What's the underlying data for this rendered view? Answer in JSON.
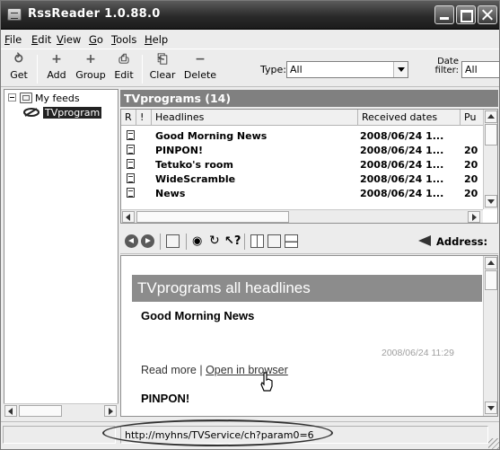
{
  "window": {
    "title": "RssReader 1.0.88.0"
  },
  "menu": [
    "File",
    "Edit",
    "View",
    "Go",
    "Tools",
    "Help"
  ],
  "toolbar": {
    "get": "Get",
    "add": "Add",
    "group": "Group",
    "edit": "Edit",
    "clear": "Clear",
    "delete": "Delete",
    "type_label": "Type:",
    "type_value": "All",
    "date_label_1": "Date",
    "date_label_2": "filter:",
    "date_value": "All"
  },
  "tree": {
    "root": "My feeds",
    "child": "TVprogram"
  },
  "list": {
    "title": "TVprograms (14)",
    "columns": {
      "read": "R",
      "flag": "!",
      "headlines": "Headlines",
      "received": "Received dates",
      "published": "Pu"
    },
    "rows": [
      {
        "headline": "Good Morning News",
        "received": "2008/06/24 1...",
        "published": ""
      },
      {
        "headline": "PINPON!",
        "received": "2008/06/24 1...",
        "published": "20"
      },
      {
        "headline": "Tetuko's room",
        "received": "2008/06/24 1...",
        "published": "20"
      },
      {
        "headline": "WideScramble",
        "received": "2008/06/24 1...",
        "published": "20"
      },
      {
        "headline": "News",
        "received": "2008/06/24 1...",
        "published": "20"
      }
    ]
  },
  "browser": {
    "address_label": "Address:"
  },
  "content": {
    "title": "TVprograms all headlines",
    "item1": "Good Morning News",
    "date": "2008/06/24 11:29",
    "read_more": "Read more",
    "separator": "|",
    "open_in_browser": "Open in browser",
    "item2": "PINPON!"
  },
  "status": {
    "url": "http://myhns/TVService/ch?param0=6"
  }
}
